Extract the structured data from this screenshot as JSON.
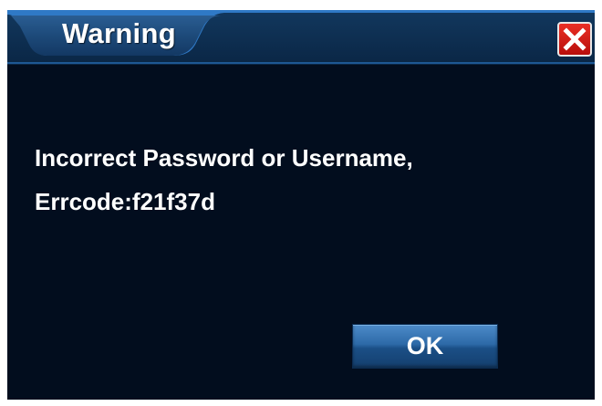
{
  "dialog": {
    "title": "Warning",
    "message_line1": "Incorrect Password or Username,",
    "message_line2": "Errcode:f21f37d",
    "ok_label": "OK",
    "close_icon": "close-icon",
    "colors": {
      "background": "#020d1e",
      "title_bar": "#0e3052",
      "close_button": "#d51c16",
      "ok_button": "#2d6aa8",
      "text": "#ffffff"
    }
  }
}
